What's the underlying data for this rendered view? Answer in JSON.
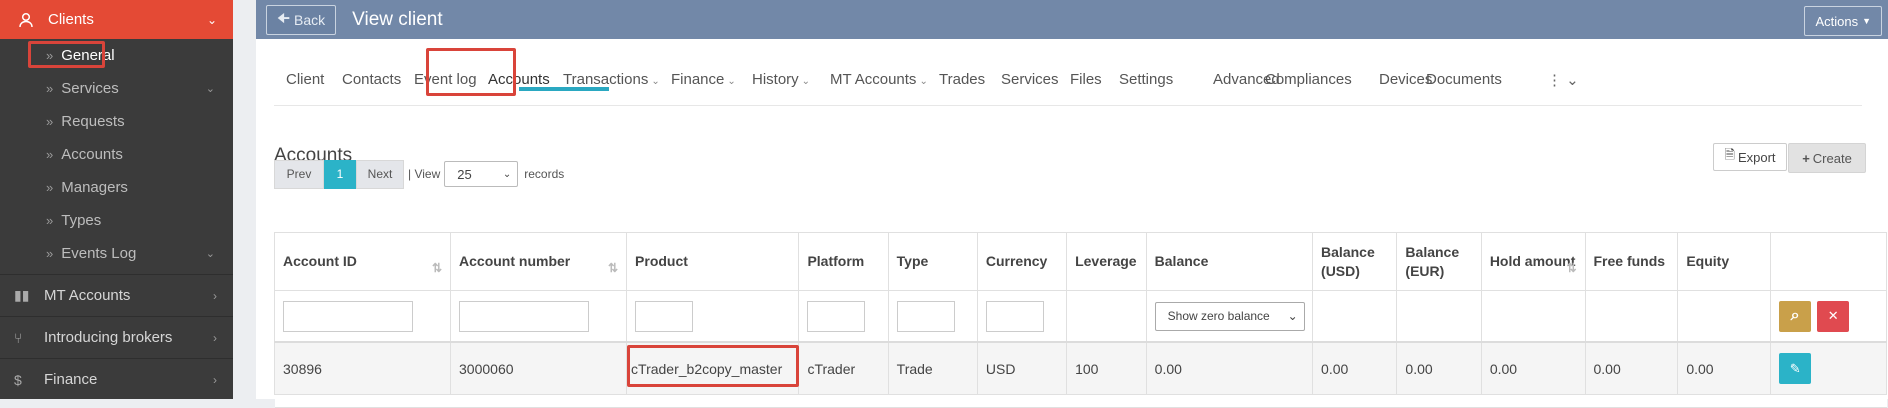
{
  "sidebar": {
    "active": {
      "label": "Clients"
    },
    "sub_items": [
      {
        "label": "General",
        "chevron": false
      },
      {
        "label": "Services",
        "chevron": true
      },
      {
        "label": "Requests",
        "chevron": false
      },
      {
        "label": "Accounts",
        "chevron": false
      },
      {
        "label": "Managers",
        "chevron": false
      },
      {
        "label": "Types",
        "chevron": false
      },
      {
        "label": "Events Log",
        "chevron": true
      }
    ],
    "main_items": [
      {
        "label": "MT Accounts",
        "icon": "bar-chart-icon"
      },
      {
        "label": "Introducing brokers",
        "icon": "tree-icon"
      },
      {
        "label": "Finance",
        "icon": "currency-icon"
      }
    ]
  },
  "topbar": {
    "back_label": "Back",
    "title": "View client",
    "actions_label": "Actions"
  },
  "tabs": [
    {
      "label": "Client",
      "dropdown": false
    },
    {
      "label": "Contacts",
      "dropdown": false
    },
    {
      "label": "Event log",
      "dropdown": false
    },
    {
      "label": "Accounts",
      "dropdown": false,
      "active": true
    },
    {
      "label": "Transactions",
      "dropdown": true
    },
    {
      "label": "Finance",
      "dropdown": true
    },
    {
      "label": "History",
      "dropdown": true
    },
    {
      "label": "MT Accounts",
      "dropdown": true
    },
    {
      "label": "Trades",
      "dropdown": false
    },
    {
      "label": "Services",
      "dropdown": false
    },
    {
      "label": "Files",
      "dropdown": false
    },
    {
      "label": "Settings",
      "dropdown": false
    },
    {
      "label": "Advanced",
      "dropdown": false
    },
    {
      "label": "Compliances",
      "dropdown": false
    },
    {
      "label": "Devices",
      "dropdown": false
    },
    {
      "label": "Documents",
      "dropdown": false
    }
  ],
  "section": {
    "title": "Accounts",
    "export_label": "Export",
    "create_label": "Create"
  },
  "pager": {
    "prev": "Prev",
    "current": "1",
    "next": "Next",
    "view_label": "| View",
    "page_size": "25",
    "records_label": "records"
  },
  "table": {
    "columns": [
      {
        "label": "Account ID",
        "sortable": true
      },
      {
        "label": "Account number",
        "sortable": true
      },
      {
        "label": "Product",
        "sortable": false
      },
      {
        "label": "Platform",
        "sortable": false
      },
      {
        "label": "Type",
        "sortable": false
      },
      {
        "label": "Currency",
        "sortable": false
      },
      {
        "label": "Leverage",
        "sortable": false
      },
      {
        "label": "Balance",
        "sortable": false
      },
      {
        "label": "Balance (USD)",
        "sortable": false
      },
      {
        "label": "Balance (EUR)",
        "sortable": false
      },
      {
        "label": "Hold amount",
        "sortable": true
      },
      {
        "label": "Free funds",
        "sortable": false
      },
      {
        "label": "Equity",
        "sortable": false
      }
    ],
    "balance_filter": "Show zero balance",
    "rows": [
      [
        "30896",
        "3000060",
        "cTrader_b2copy_master",
        "cTrader",
        "Trade",
        "USD",
        "100",
        "0.00",
        "0.00",
        "0.00",
        "0.00",
        "0.00",
        "0.00"
      ]
    ]
  },
  "colors": {
    "accent_red": "#e44a35",
    "teal": "#2bb3c8",
    "topbar": "#7288a8",
    "highlight": "#d9443a"
  }
}
